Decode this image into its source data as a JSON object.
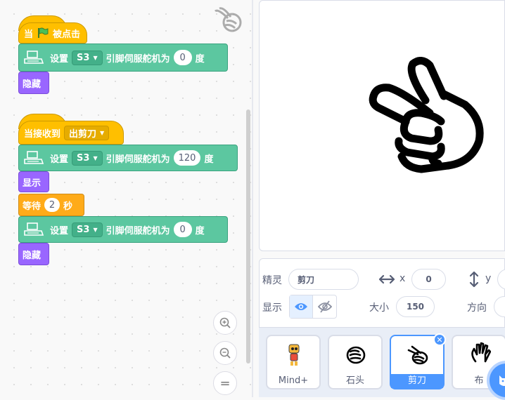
{
  "scripts": {
    "script1": {
      "hat_prefix": "当",
      "hat_suffix": "被点击",
      "servo_set": "设置",
      "servo_pin": "S3",
      "servo_text": "引脚伺服舵机为",
      "servo_value": "0",
      "servo_unit": "度",
      "hide": "隐藏"
    },
    "script2": {
      "hat_label": "当接收到",
      "message": "出剪刀",
      "servo1_set": "设置",
      "servo1_pin": "S3",
      "servo1_text": "引脚伺服舵机为",
      "servo1_value": "120",
      "servo1_unit": "度",
      "show": "显示",
      "wait_label": "等待",
      "wait_value": "2",
      "wait_unit": "秒",
      "servo2_set": "设置",
      "servo2_pin": "S3",
      "servo2_text": "引脚伺服舵机为",
      "servo2_value": "0",
      "servo2_unit": "度",
      "hide": "隐藏"
    }
  },
  "zoom": {
    "in": "+",
    "out": "−",
    "reset": "="
  },
  "sprite_info": {
    "sprite_label": "精灵",
    "sprite_name": "剪刀",
    "x_label": "x",
    "x_value": "0",
    "y_label": "y",
    "show_label": "显示",
    "size_label": "大小",
    "size_value": "150",
    "direction_label": "方向"
  },
  "sprites": [
    {
      "name": "Mind+",
      "selected": false
    },
    {
      "name": "石头",
      "selected": false
    },
    {
      "name": "剪刀",
      "selected": true
    },
    {
      "name": "布",
      "selected": false
    }
  ],
  "colors": {
    "events": "#ffbf00",
    "extension": "#5cc7a0",
    "looks": "#9966ff",
    "control": "#ffab19",
    "accent": "#4c97ff"
  }
}
